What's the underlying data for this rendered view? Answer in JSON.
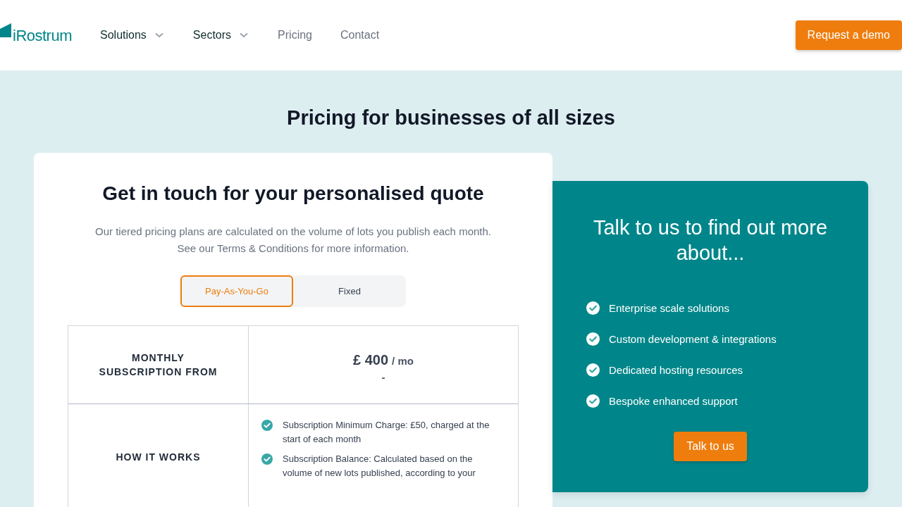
{
  "header": {
    "logo": "iRostrum",
    "nav": [
      {
        "label": "Solutions",
        "has_menu": true
      },
      {
        "label": "Sectors",
        "has_menu": true
      },
      {
        "label": "Pricing",
        "has_menu": false
      },
      {
        "label": "Contact",
        "has_menu": false
      }
    ],
    "cta": "Request a demo"
  },
  "page_title": "Pricing for businesses of all sizes",
  "quote_card": {
    "title": "Get in touch for your personalised quote",
    "intro": [
      "Our tiered pricing plans are calculated on the volume of lots you publish each month.",
      "See our Terms & Conditions for more information."
    ],
    "toggle": [
      {
        "label": "Pay-As-You-Go",
        "selected": true
      },
      {
        "label": "Fixed",
        "selected": false
      }
    ],
    "rows": [
      {
        "kind": "price",
        "label": "MONTHLY SUBSCRIPTION FROM",
        "price": "£ 400",
        "unit": "/ mo",
        "note": "-"
      },
      {
        "kind": "list",
        "label": "HOW IT WORKS",
        "items": [
          "Subscription Minimum Charge: £50, charged at the start of each month",
          "Subscription Balance: Calculated based on the volume of new lots published, according to your"
        ]
      }
    ]
  },
  "contact_card": {
    "title": "Talk to us to find out more about...",
    "items": [
      "Enterprise scale solutions",
      "Custom development & integrations",
      "Dedicated hosting resources",
      "Bespoke enhanced support"
    ],
    "button": "Talk to us"
  }
}
